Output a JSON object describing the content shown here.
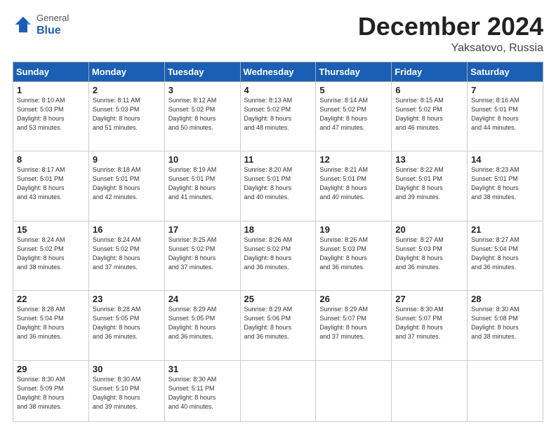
{
  "header": {
    "logo_general": "General",
    "logo_blue": "Blue",
    "month": "December 2024",
    "location": "Yaksatovo, Russia"
  },
  "days_of_week": [
    "Sunday",
    "Monday",
    "Tuesday",
    "Wednesday",
    "Thursday",
    "Friday",
    "Saturday"
  ],
  "weeks": [
    [
      {
        "day": "1",
        "text": "Sunrise: 8:10 AM\nSunset: 5:03 PM\nDaylight: 8 hours\nand 53 minutes."
      },
      {
        "day": "2",
        "text": "Sunrise: 8:11 AM\nSunset: 5:03 PM\nDaylight: 8 hours\nand 51 minutes."
      },
      {
        "day": "3",
        "text": "Sunrise: 8:12 AM\nSunset: 5:02 PM\nDaylight: 8 hours\nand 50 minutes."
      },
      {
        "day": "4",
        "text": "Sunrise: 8:13 AM\nSunset: 5:02 PM\nDaylight: 8 hours\nand 48 minutes."
      },
      {
        "day": "5",
        "text": "Sunrise: 8:14 AM\nSunset: 5:02 PM\nDaylight: 8 hours\nand 47 minutes."
      },
      {
        "day": "6",
        "text": "Sunrise: 8:15 AM\nSunset: 5:02 PM\nDaylight: 8 hours\nand 46 minutes."
      },
      {
        "day": "7",
        "text": "Sunrise: 8:16 AM\nSunset: 5:01 PM\nDaylight: 8 hours\nand 44 minutes."
      }
    ],
    [
      {
        "day": "8",
        "text": "Sunrise: 8:17 AM\nSunset: 5:01 PM\nDaylight: 8 hours\nand 43 minutes."
      },
      {
        "day": "9",
        "text": "Sunrise: 8:18 AM\nSunset: 5:01 PM\nDaylight: 8 hours\nand 42 minutes."
      },
      {
        "day": "10",
        "text": "Sunrise: 8:19 AM\nSunset: 5:01 PM\nDaylight: 8 hours\nand 41 minutes."
      },
      {
        "day": "11",
        "text": "Sunrise: 8:20 AM\nSunset: 5:01 PM\nDaylight: 8 hours\nand 40 minutes."
      },
      {
        "day": "12",
        "text": "Sunrise: 8:21 AM\nSunset: 5:01 PM\nDaylight: 8 hours\nand 40 minutes."
      },
      {
        "day": "13",
        "text": "Sunrise: 8:22 AM\nSunset: 5:01 PM\nDaylight: 8 hours\nand 39 minutes."
      },
      {
        "day": "14",
        "text": "Sunrise: 8:23 AM\nSunset: 5:01 PM\nDaylight: 8 hours\nand 38 minutes."
      }
    ],
    [
      {
        "day": "15",
        "text": "Sunrise: 8:24 AM\nSunset: 5:02 PM\nDaylight: 8 hours\nand 38 minutes."
      },
      {
        "day": "16",
        "text": "Sunrise: 8:24 AM\nSunset: 5:02 PM\nDaylight: 8 hours\nand 37 minutes."
      },
      {
        "day": "17",
        "text": "Sunrise: 8:25 AM\nSunset: 5:02 PM\nDaylight: 8 hours\nand 37 minutes."
      },
      {
        "day": "18",
        "text": "Sunrise: 8:26 AM\nSunset: 5:02 PM\nDaylight: 8 hours\nand 36 minutes."
      },
      {
        "day": "19",
        "text": "Sunrise: 8:26 AM\nSunset: 5:03 PM\nDaylight: 8 hours\nand 36 minutes."
      },
      {
        "day": "20",
        "text": "Sunrise: 8:27 AM\nSunset: 5:03 PM\nDaylight: 8 hours\nand 36 minutes."
      },
      {
        "day": "21",
        "text": "Sunrise: 8:27 AM\nSunset: 5:04 PM\nDaylight: 8 hours\nand 36 minutes."
      }
    ],
    [
      {
        "day": "22",
        "text": "Sunrise: 8:28 AM\nSunset: 5:04 PM\nDaylight: 8 hours\nand 36 minutes."
      },
      {
        "day": "23",
        "text": "Sunrise: 8:28 AM\nSunset: 5:05 PM\nDaylight: 8 hours\nand 36 minutes."
      },
      {
        "day": "24",
        "text": "Sunrise: 8:29 AM\nSunset: 5:05 PM\nDaylight: 8 hours\nand 36 minutes."
      },
      {
        "day": "25",
        "text": "Sunrise: 8:29 AM\nSunset: 5:06 PM\nDaylight: 8 hours\nand 36 minutes."
      },
      {
        "day": "26",
        "text": "Sunrise: 8:29 AM\nSunset: 5:07 PM\nDaylight: 8 hours\nand 37 minutes."
      },
      {
        "day": "27",
        "text": "Sunrise: 8:30 AM\nSunset: 5:07 PM\nDaylight: 8 hours\nand 37 minutes."
      },
      {
        "day": "28",
        "text": "Sunrise: 8:30 AM\nSunset: 5:08 PM\nDaylight: 8 hours\nand 38 minutes."
      }
    ],
    [
      {
        "day": "29",
        "text": "Sunrise: 8:30 AM\nSunset: 5:09 PM\nDaylight: 8 hours\nand 38 minutes."
      },
      {
        "day": "30",
        "text": "Sunrise: 8:30 AM\nSunset: 5:10 PM\nDaylight: 8 hours\nand 39 minutes."
      },
      {
        "day": "31",
        "text": "Sunrise: 8:30 AM\nSunset: 5:11 PM\nDaylight: 8 hours\nand 40 minutes."
      },
      {
        "day": "",
        "text": ""
      },
      {
        "day": "",
        "text": ""
      },
      {
        "day": "",
        "text": ""
      },
      {
        "day": "",
        "text": ""
      }
    ]
  ]
}
